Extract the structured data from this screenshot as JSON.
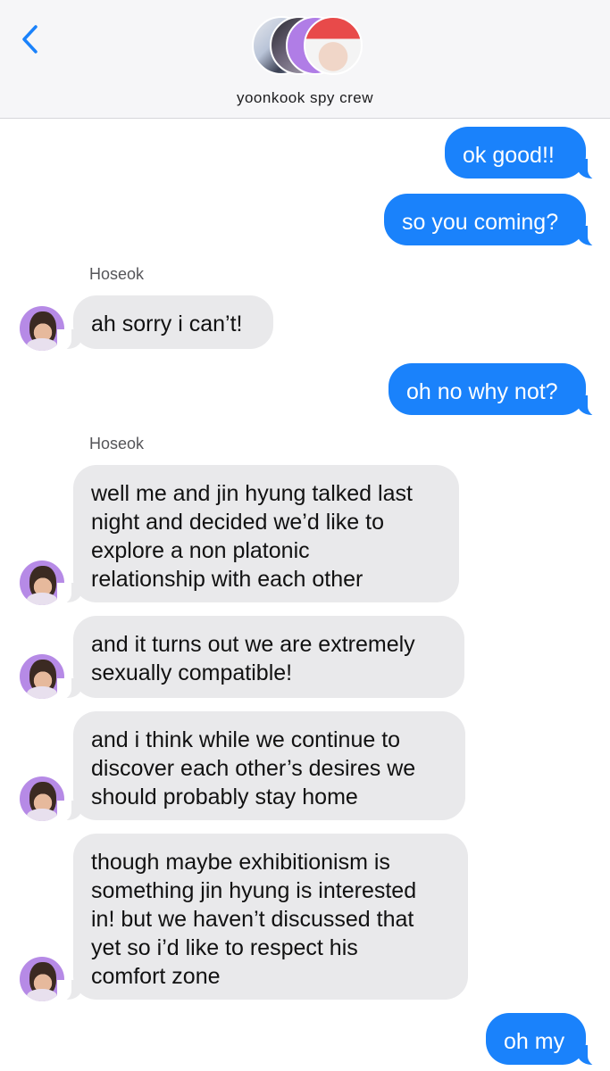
{
  "header": {
    "group_name": "yoonkook spy crew",
    "back_icon": "chevron-left-icon",
    "accent": "#1a82fb"
  },
  "colors": {
    "outgoing": "#1a82fb",
    "incoming": "#e9e9eb"
  },
  "messages": [
    {
      "from": "me",
      "text": "ok good!!"
    },
    {
      "from": "me",
      "text": "so you coming?"
    },
    {
      "from": "Hoseok",
      "sender_label": "Hoseok",
      "text": "ah sorry i can’t!"
    },
    {
      "from": "me",
      "text": "oh no why not?"
    },
    {
      "from": "Hoseok",
      "sender_label": "Hoseok",
      "lines": [
        "well me and jin hyung talked last",
        "night and decided we’d like to",
        "explore a non platonic",
        "relationship with each other"
      ]
    },
    {
      "from": "Hoseok",
      "lines": [
        "and it turns out we are extremely",
        "sexually compatible!"
      ]
    },
    {
      "from": "Hoseok",
      "lines": [
        "and i think while we continue to",
        "discover each other’s desires we",
        "should probably stay home"
      ]
    },
    {
      "from": "Hoseok",
      "lines": [
        "though maybe exhibitionism is",
        "something jin hyung is interested",
        "in! but we haven’t discussed that",
        "yet so i’d like to respect his",
        "comfort zone"
      ]
    },
    {
      "from": "me",
      "text": "oh my"
    }
  ]
}
